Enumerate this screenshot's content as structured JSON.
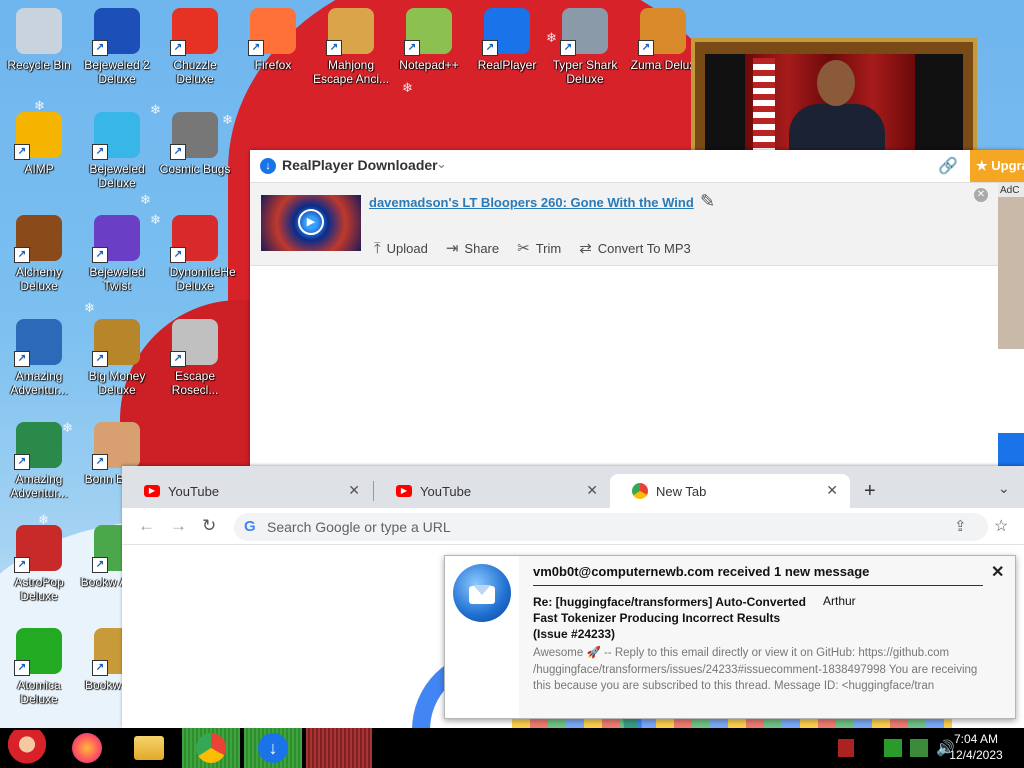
{
  "desktop": {
    "icons": [
      {
        "label": "Recycle Bin",
        "color": "#c9d3de"
      },
      {
        "label": "Bejeweled 2 Deluxe",
        "color": "#1d4fb8"
      },
      {
        "label": "Chuzzle Deluxe",
        "color": "#e53225"
      },
      {
        "label": "Firefox",
        "color": "#ff7139"
      },
      {
        "label": "Mahjong Escape Anci...",
        "color": "#d9a44a"
      },
      {
        "label": "Notepad++",
        "color": "#8cc152"
      },
      {
        "label": "RealPlayer",
        "color": "#1a73e8"
      },
      {
        "label": "Typer Shark Deluxe",
        "color": "#8a9aa8"
      },
      {
        "label": "Zuma Delux",
        "color": "#d88a2a"
      },
      {
        "label": "AIMP",
        "color": "#f4b400"
      },
      {
        "label": "Bejeweled Deluxe",
        "color": "#38b6e8"
      },
      {
        "label": "Cosmic Bugs",
        "color": "#777777"
      },
      {
        "label": "Alchemy Deluxe",
        "color": "#8a4a1a"
      },
      {
        "label": "Bejeweled Twist",
        "color": "#6a3fc6"
      },
      {
        "label": "Dynomite Deluxe",
        "color": "#d82a2a"
      },
      {
        "label": "Amazing Adventur...",
        "color": "#2a6ab8"
      },
      {
        "label": "Big Money Deluxe",
        "color": "#b8862a"
      },
      {
        "label": "Escape Rosecl...",
        "color": "#c0c0c0"
      },
      {
        "label": "Amazing Adventur...",
        "color": "#2a8a4a"
      },
      {
        "label": "Bonn Books",
        "color": "#d8a070"
      },
      {
        "label": "AstroPop Deluxe",
        "color": "#c82a2a"
      },
      {
        "label": "Bookw Adven",
        "color": "#4aa84a"
      },
      {
        "label": "Atomica Deluxe",
        "color": "#22aa22"
      },
      {
        "label": "Bookw Delu",
        "color": "#c89a3a"
      },
      {
        "label": "He",
        "color": "#cc1f26"
      }
    ]
  },
  "realplayer": {
    "title": "RealPlayer Downloader",
    "upgrade_label": "★ Upgra",
    "ad_label": "AdC",
    "video_title": "davemadson's LT Bloopers 260: Gone With the Wind",
    "actions": [
      {
        "label": "Upload",
        "icon": "upload-icon"
      },
      {
        "label": "Share",
        "icon": "share-icon"
      },
      {
        "label": "Trim",
        "icon": "scissors-icon"
      },
      {
        "label": "Convert To MP3",
        "icon": "convert-icon"
      }
    ]
  },
  "chrome": {
    "tabs": [
      {
        "label": "YouTube",
        "active": false
      },
      {
        "label": "YouTube",
        "active": false
      },
      {
        "label": "New Tab",
        "active": true
      }
    ],
    "omnibox_placeholder": "Search Google or type a URL"
  },
  "notification": {
    "header": "vm0b0t@computernewb.com received 1 new message",
    "subject": "Re: [huggingface/transformers] Auto-Converted Fast Tokenizer Producing Incorrect Results (Issue #24233)",
    "sender": "Arthur",
    "body": "Awesome 🚀 -- Reply to this email directly or view it on GitHub: https://github.com /huggingface/transformers/issues/24233#issuecomment-1838497998 You are receiving this because you are subscribed to this thread. Message ID: <huggingface/tran"
  },
  "taskbar": {
    "time": "7:04 AM",
    "date": "12/4/2023"
  }
}
